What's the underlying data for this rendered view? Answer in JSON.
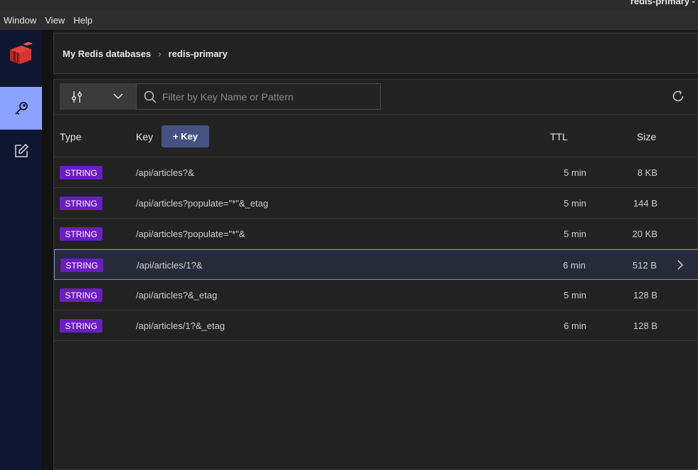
{
  "window": {
    "title": "redis-primary -"
  },
  "menu": [
    "Window",
    "View",
    "Help"
  ],
  "breadcrumb": {
    "root": "My Redis databases",
    "current": "redis-primary"
  },
  "toolbar": {
    "search_placeholder": "Filter by Key Name or Pattern"
  },
  "table": {
    "headers": {
      "type": "Type",
      "key": "Key",
      "ttl": "TTL",
      "size": "Size"
    },
    "add_key_label": "+ Key",
    "rows": [
      {
        "type": "STRING",
        "key": "/api/articles?&",
        "ttl": "5 min",
        "size": "8 KB"
      },
      {
        "type": "STRING",
        "key": "/api/articles?populate=\"*\"&_etag",
        "ttl": "5 min",
        "size": "144 B"
      },
      {
        "type": "STRING",
        "key": "/api/articles?populate=\"*\"&",
        "ttl": "5 min",
        "size": "20 KB"
      },
      {
        "type": "STRING",
        "key": "/api/articles/1?&",
        "ttl": "6 min",
        "size": "512 B",
        "selected": true
      },
      {
        "type": "STRING",
        "key": "/api/articles?&_etag",
        "ttl": "5 min",
        "size": "128 B"
      },
      {
        "type": "STRING",
        "key": "/api/articles/1?&_etag",
        "ttl": "6 min",
        "size": "128 B"
      }
    ]
  },
  "colors": {
    "badge": "#6a1dc4",
    "active_nav": "#8ba2ff",
    "add_key": "#465282",
    "sidebar": "#0f1730"
  },
  "icons": [
    "redis-logo",
    "key-icon",
    "edit-icon",
    "filter-icon",
    "chevron-down-icon",
    "search-icon",
    "refresh-icon",
    "chevron-right-icon"
  ]
}
